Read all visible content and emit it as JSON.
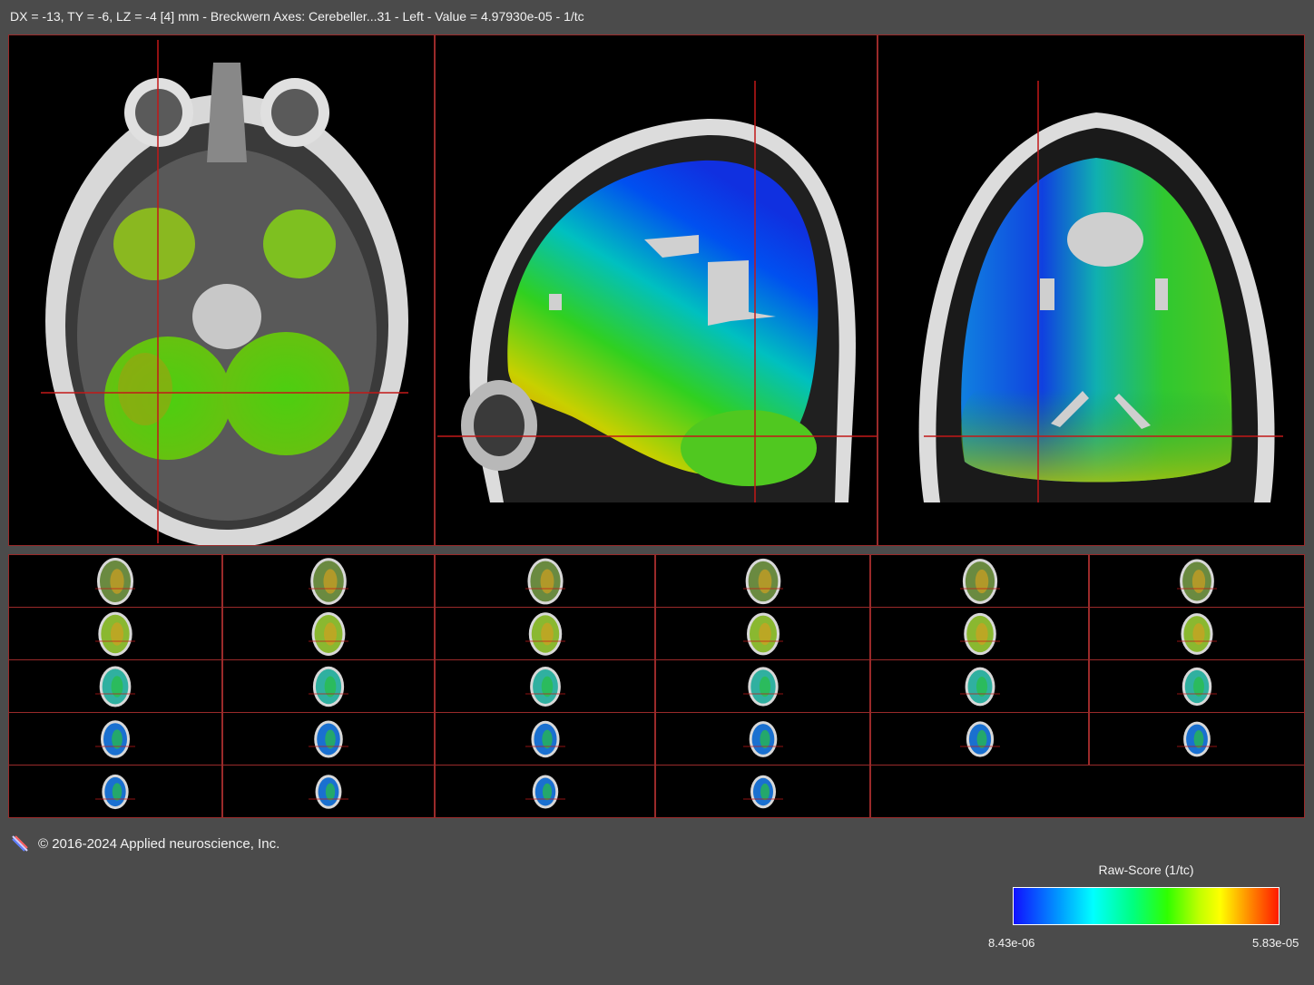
{
  "status": {
    "text": "DX = -13, TY = -6, LZ = -4 [4] mm - Breckwern Axes: Cerebeller...31 - Left  -  Value = 4.97930e-05 - 1/tc"
  },
  "views": {
    "axial": {
      "view_name": "axial"
    },
    "sagittal": {
      "view_name": "sagittal"
    },
    "coronal": {
      "view_name": "coronal"
    }
  },
  "thumbnails": {
    "rows": 5,
    "cols": 6,
    "slice_count": 28
  },
  "footer": {
    "copyright": "© 2016-2024 Applied neuroscience, Inc."
  },
  "colorbar": {
    "title": "Raw-Score (1/tc)",
    "min_label": "8.43e-06",
    "max_label": "5.83e-05",
    "colors": [
      "#1010ff",
      "#00a0ff",
      "#00ffff",
      "#00ff80",
      "#30ff00",
      "#c0ff00",
      "#ffff00",
      "#ff8000",
      "#ff1a00"
    ]
  },
  "crosshair_color": "#c21818",
  "border_color": "#9a2a2a"
}
